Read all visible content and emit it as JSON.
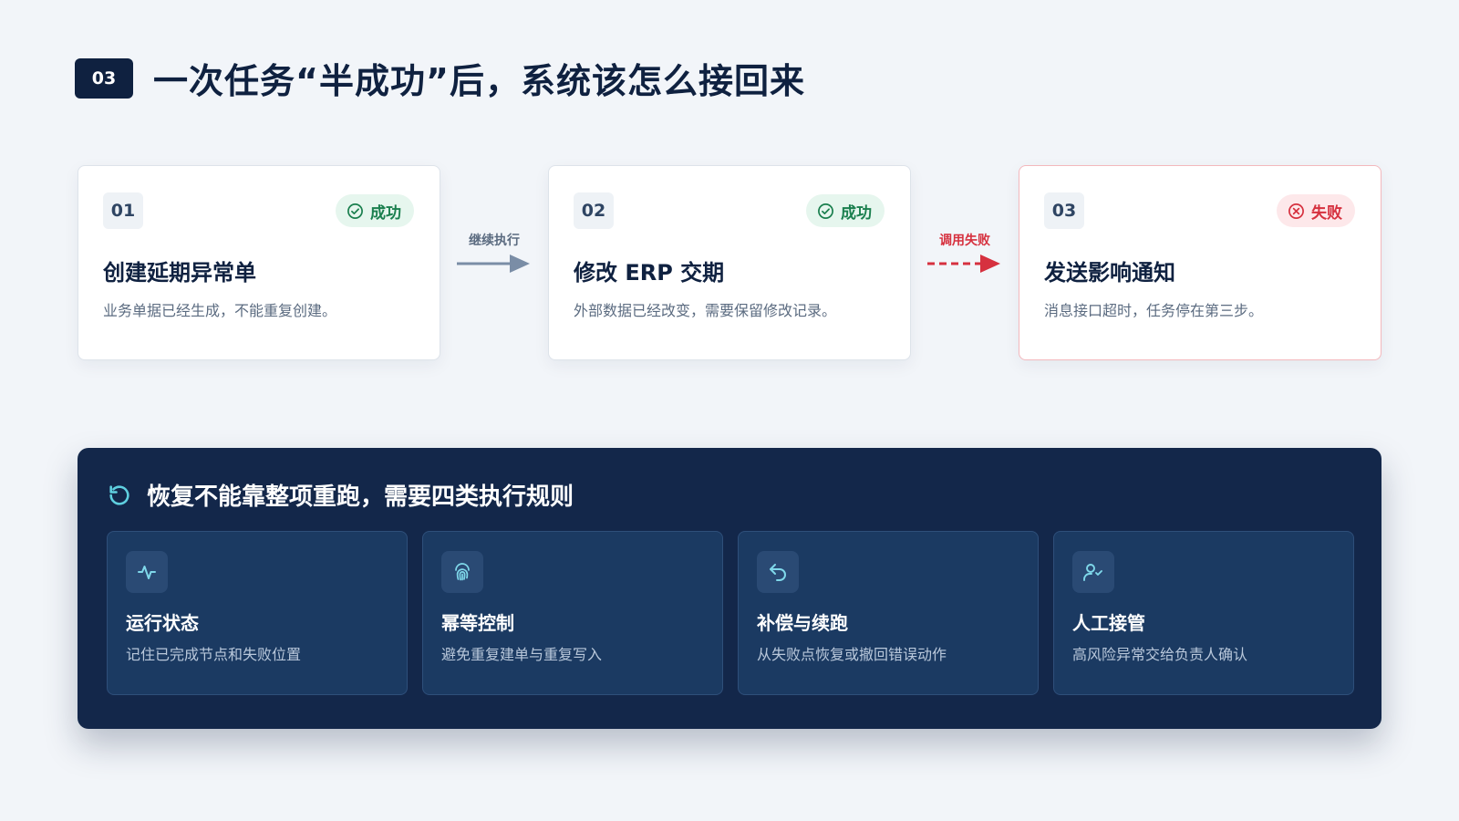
{
  "header": {
    "badge": "03",
    "title": "一次任务“半成功”后，系统该怎么接回来"
  },
  "steps": [
    {
      "num": "01",
      "status": "成功",
      "status_type": "success",
      "title": "创建延期异常单",
      "desc": "业务单据已经生成，不能重复创建。"
    },
    {
      "num": "02",
      "status": "成功",
      "status_type": "success",
      "title": "修改 ERP 交期",
      "desc": "外部数据已经改变，需要保留修改记录。"
    },
    {
      "num": "03",
      "status": "失败",
      "status_type": "failed",
      "title": "发送影响通知",
      "desc": "消息接口超时，任务停在第三步。"
    }
  ],
  "connectors": [
    {
      "label": "继续执行",
      "style": "solid",
      "color": "#7a8da6"
    },
    {
      "label": "调用失败",
      "style": "dashed",
      "color": "#d6313f"
    }
  ],
  "panel": {
    "title": "恢复不能靠整项重跑，需要四类执行规则",
    "icon": "refresh-icon",
    "rules": [
      {
        "icon": "activity-icon",
        "title": "运行状态",
        "desc": "记住已完成节点和失败位置"
      },
      {
        "icon": "fingerprint-icon",
        "title": "幂等控制",
        "desc": "避免重复建单与重复写入"
      },
      {
        "icon": "undo-icon",
        "title": "补偿与续跑",
        "desc": "从失败点恢复或撤回错误动作"
      },
      {
        "icon": "user-check-icon",
        "title": "人工接管",
        "desc": "高风险异常交给负责人确认"
      }
    ]
  },
  "colors": {
    "navy": "#0f2140",
    "panel_bg": "#13274a",
    "success": "#1a7f4e",
    "failure": "#d6313f",
    "accent_cyan": "#5fd0e0"
  }
}
